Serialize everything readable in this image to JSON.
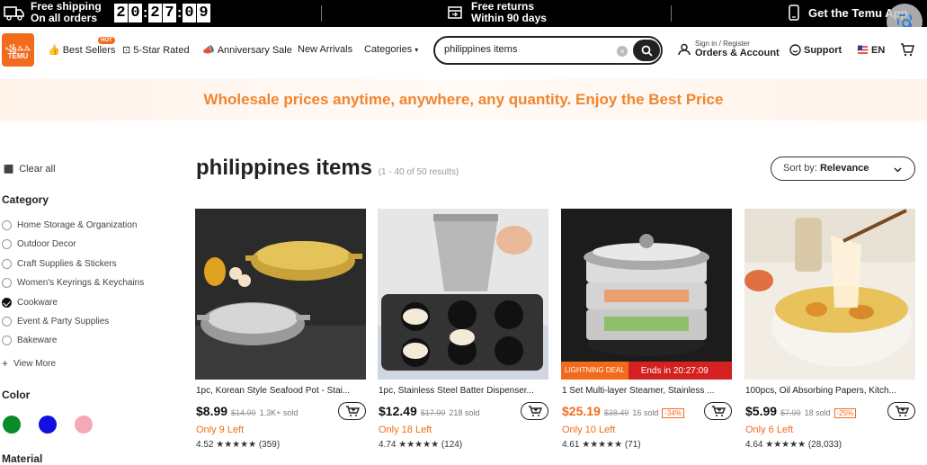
{
  "topbar": {
    "shipping_line1": "Free shipping",
    "shipping_line2": "On all orders",
    "timer": [
      "2",
      "0",
      "2",
      "7",
      "0",
      "9"
    ],
    "returns_line1": "Free returns",
    "returns_line2": "Within 90 days",
    "app": "Get the Temu App"
  },
  "nav": {
    "logo_line1": "꧁ⲆⲆ",
    "logo_line2": "TEMU",
    "best_sellers": "Best Sellers",
    "hot_badge": "HOT",
    "five_star": "5-Star Rated",
    "anniversary": "Anniversary Sale",
    "new_arrivals": "New Arrivals",
    "categories": "Categories",
    "search_value": "philippines items",
    "signin_small": "Sign in / Register",
    "signin_big": "Orders & Account",
    "support": "Support",
    "lang": "EN"
  },
  "banner": "Wholesale prices anytime, anywhere, any quantity. Enjoy the Best Price",
  "sidebar": {
    "clear_all": "Clear all",
    "category_heading": "Category",
    "categories": [
      {
        "label": "Home Storage & Organization",
        "checked": false
      },
      {
        "label": "Outdoor Decor",
        "checked": false
      },
      {
        "label": "Craft Supplies & Stickers",
        "checked": false
      },
      {
        "label": "Women's Keyrings & Keychains",
        "checked": false
      },
      {
        "label": "Cookware",
        "checked": true
      },
      {
        "label": "Event & Party Supplies",
        "checked": false
      },
      {
        "label": "Bakeware",
        "checked": false
      }
    ],
    "view_more": "View More",
    "color_heading": "Color",
    "colors": [
      "#0a8a2a",
      "#1010e0",
      "#f5a8b8"
    ],
    "material_heading": "Material"
  },
  "results": {
    "title": "philippines items",
    "count": "(1 - 40 of 50 results)",
    "sort_label": "Sort by:",
    "sort_value": "Relevance"
  },
  "products": [
    {
      "name": "1pc, Korean Style Seafood Pot - Stai...",
      "price": "$8.99",
      "old": "$14.99",
      "sold": "1.3K+ sold",
      "discount": "",
      "left": "Only 9 Left",
      "rating": "4.52 ★★★★★ (359)"
    },
    {
      "name": "1pc, Stainless Steel Batter Dispenser...",
      "price": "$12.49",
      "old": "$17.99",
      "sold": "218 sold",
      "discount": "",
      "left": "Only 18 Left",
      "rating": "4.74 ★★★★★ (124)"
    },
    {
      "name": "1 Set Multi-layer Steamer, Stainless ...",
      "price": "$25.19",
      "old": "$38.49",
      "sold": "16 sold",
      "discount": "-34%",
      "left": "Only 10 Left",
      "rating": "4.61 ★★★★★ (71)",
      "ends": "Ends in 20:27:09",
      "ends_tag": "LIGHTNING DEAL"
    },
    {
      "name": "100pcs, Oil Absorbing Papers, Kitch...",
      "price": "$5.99",
      "old": "$7.99",
      "sold": "18 sold",
      "discount": "-25%",
      "left": "Only 6 Left",
      "rating": "4.64 ★★★★★ (28,033)"
    }
  ],
  "accent_color": "#f26b1d"
}
